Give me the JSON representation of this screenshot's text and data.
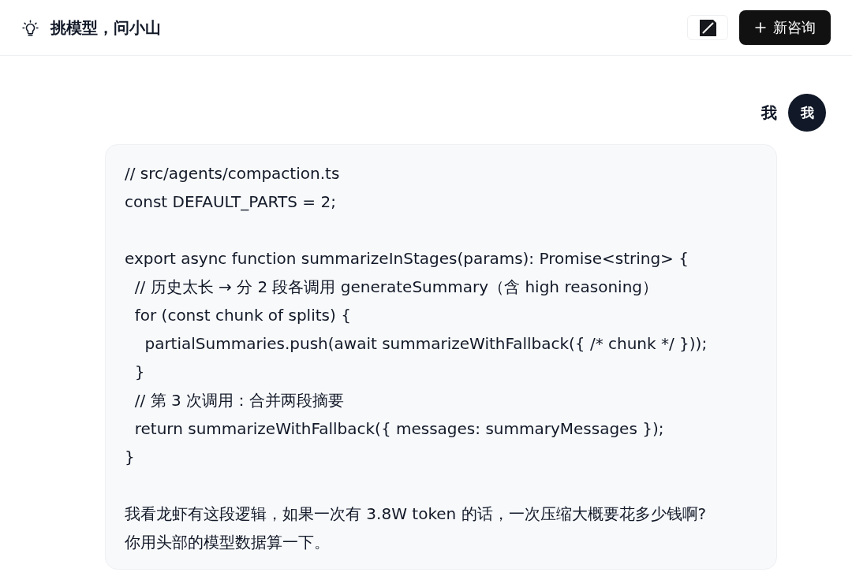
{
  "header": {
    "title": "挑模型，问小山",
    "new_chat_button": {
      "label": "新咨询"
    }
  },
  "message": {
    "sender": "我",
    "avatar": "我",
    "text": "// src/agents/compaction.ts\nconst DEFAULT_PARTS = 2;\n\nexport async function summarizeInStages(params): Promise<string> {\n  // 历史太长 → 分 2 段各调用 generateSummary（含 high reasoning）\n  for (const chunk of splits) {\n    partialSummaries.push(await summarizeWithFallback({ /* chunk */ }));\n  }\n  // 第 3 次调用：合并两段摘要\n  return summarizeWithFallback({ messages: summaryMessages });\n}\n\n我看龙虾有这段逻辑，如果一次有 3.8W token 的话，一次压缩大概要花多少钱啊?\n你用头部的模型数据算一下。"
  }
}
